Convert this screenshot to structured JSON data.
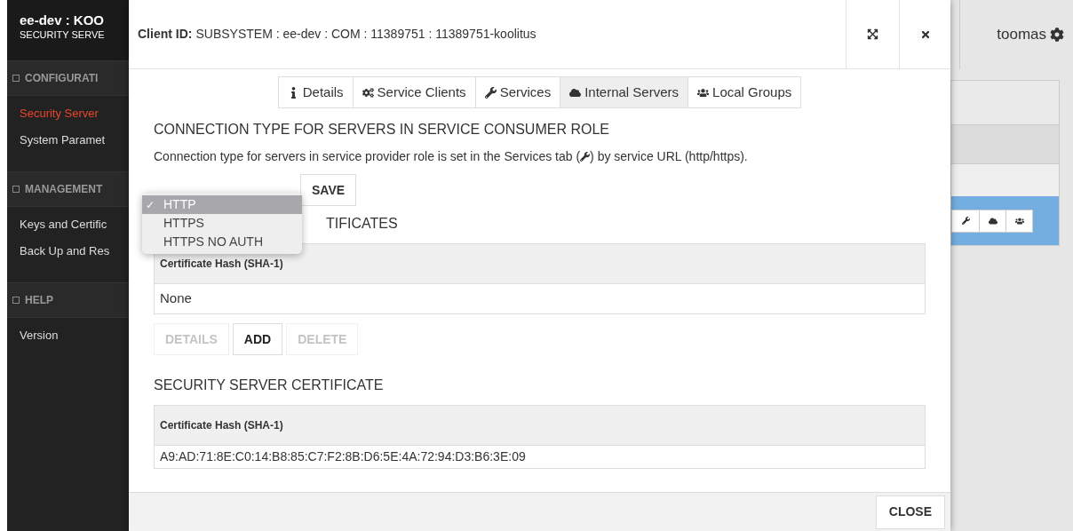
{
  "sidebar": {
    "title": "ee-dev : KOO",
    "subtitle": "SECURITY SERVE",
    "sections": [
      {
        "label": "CONFIGURATI",
        "items": [
          {
            "label": "Security Server",
            "selected": true
          },
          {
            "label": "System Paramet",
            "selected": false
          }
        ]
      },
      {
        "label": "MANAGEMENT",
        "items": [
          {
            "label": "Keys and Certific",
            "selected": false
          },
          {
            "label": "Back Up and Res",
            "selected": false
          }
        ]
      },
      {
        "label": "HELP",
        "items": [
          {
            "label": "Version",
            "selected": false
          }
        ]
      }
    ]
  },
  "dialog": {
    "title_label": "Client ID:",
    "title_value": "SUBSYSTEM : ee-dev : COM : 11389751 : 11389751-koolitus",
    "tabs": [
      {
        "label": "Details",
        "selected": false
      },
      {
        "label": "Service Clients",
        "selected": false
      },
      {
        "label": "Services",
        "selected": false
      },
      {
        "label": "Internal Servers",
        "selected": true
      },
      {
        "label": "Local Groups",
        "selected": false
      }
    ],
    "connection": {
      "heading": "CONNECTION TYPE FOR SERVERS IN SERVICE CONSUMER ROLE",
      "description_before": "Connection type for servers in service provider role is set in the Services tab (",
      "description_after": ") by service URL (http/https).",
      "options": [
        {
          "label": "HTTP",
          "selected": true
        },
        {
          "label": "HTTPS",
          "selected": false
        },
        {
          "label": "HTTPS NO AUTH",
          "selected": false
        }
      ],
      "save": "SAVE",
      "check_mark": "✓"
    },
    "internal_certificates": {
      "heading": "TIFICATES",
      "column": "Certificate Hash (SHA-1)",
      "rows": [
        "None"
      ],
      "buttons": [
        {
          "label": "DETAILS",
          "disabled": true
        },
        {
          "label": "ADD",
          "disabled": false
        },
        {
          "label": "DELETE",
          "disabled": true
        }
      ]
    },
    "server_certificate": {
      "heading": "SECURITY SERVER CERTIFICATE",
      "column": "Certificate Hash (SHA-1)",
      "rows": [
        "A9:AD:71:8E:C0:14:B8:85:C7:F2:8B:D6:5E:4A:72:94:D3:B6:3E:09"
      ]
    },
    "close": "CLOSE"
  },
  "user": "toomas"
}
